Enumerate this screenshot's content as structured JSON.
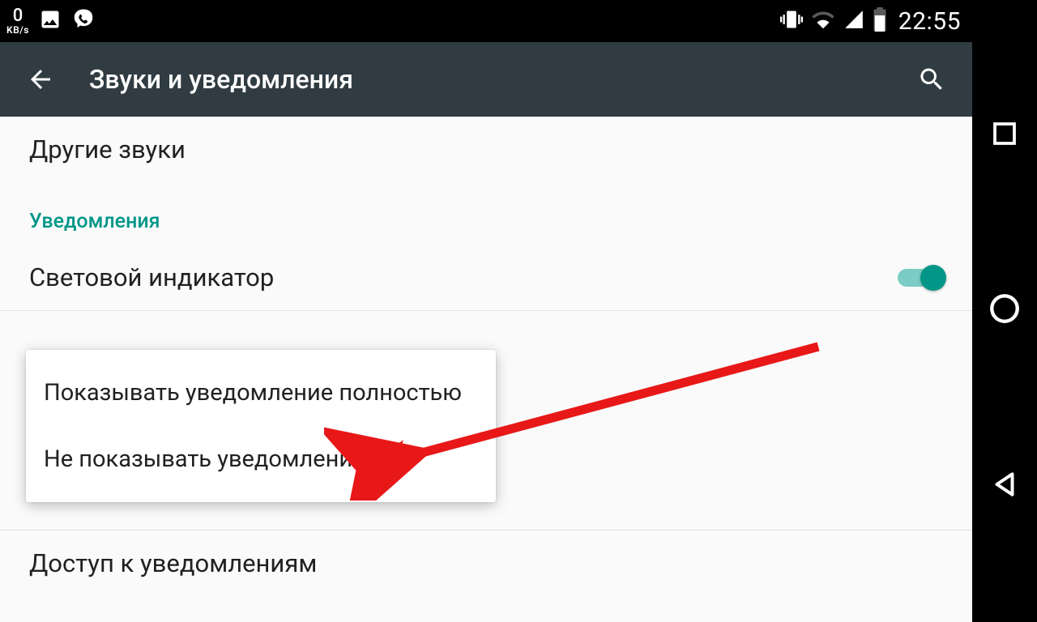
{
  "status": {
    "speed_value": "0",
    "speed_unit": "KB/s",
    "time": "22:55"
  },
  "appbar": {
    "title": "Звуки и уведомления"
  },
  "content": {
    "other_sounds": "Другие звуки",
    "section_notifications": "Уведомления",
    "light_indicator": "Световой индикатор",
    "notif_access": "Доступ к уведомлениям"
  },
  "popup": {
    "option_show_full": "Показывать уведомление полностью",
    "option_dont_show": "Не показывать уведомления"
  }
}
